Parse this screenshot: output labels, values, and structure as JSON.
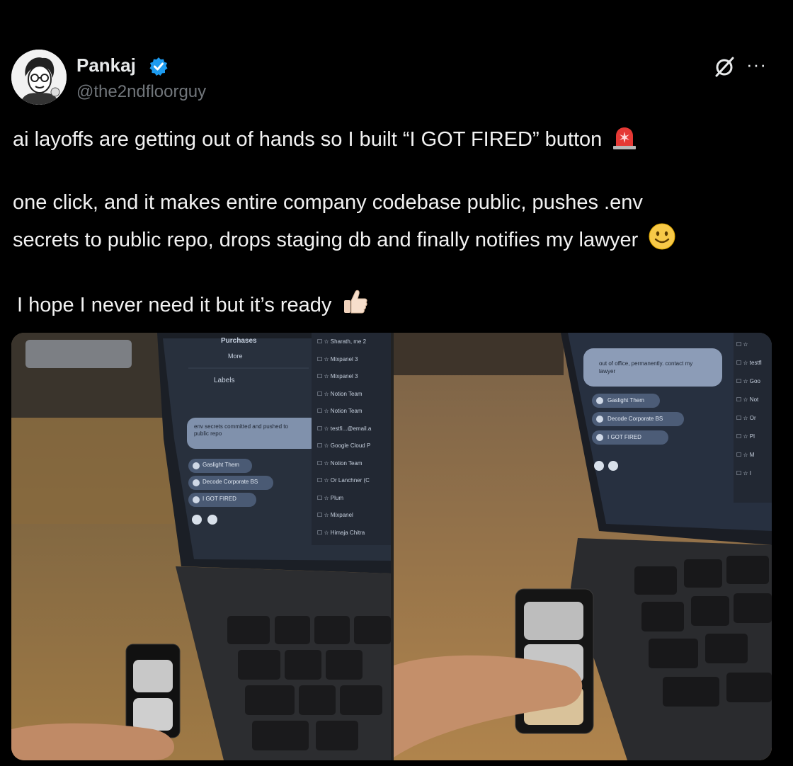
{
  "author": {
    "name": "Pankaj",
    "handle": "@the2ndfloorguy",
    "verified": true
  },
  "header_icons": [
    "grok-icon",
    "more-icon"
  ],
  "more_label": "···",
  "tweet": {
    "line1": "ai layoffs are getting out of hands so I built “I GOT FIRED” button",
    "line2": "one click, and it makes entire company codebase public, pushes .env",
    "line3": "secrets to public repo, drops staging db and finally notifies my lawyer",
    "line4": "I hope I never need it but it’s ready",
    "emojis": [
      "rotating-light-emoji",
      "smiling-face-emoji",
      "thumbs-up-emoji"
    ]
  },
  "media": {
    "left": {
      "sidebar": [
        "Purchases",
        "More",
        "Labels"
      ],
      "notification": "env secrets committed and pushed to public repo",
      "buttons": [
        "Gaslight Them",
        "Decode Corporate BS",
        "I GOT FIRED"
      ],
      "inbox_senders": [
        "Sharath, me 2",
        "Mixpanel 3",
        "Mixpanel 3",
        "Notion Team",
        "Notion Team",
        "testfi...@email.a",
        "Google Cloud P",
        "Notion Team",
        "Or Lanchner (C",
        "Plum",
        "Mixpanel",
        "Himaja Chitra"
      ]
    },
    "right": {
      "notification": "out of office, permanently. contact my lawyer",
      "buttons": [
        "Gaslight Them",
        "Decode Corporate BS",
        "I GOT FIRED"
      ],
      "inbox_senders": [
        "",
        "testfl",
        "Goo",
        "Not",
        "Or",
        "Pl",
        "M",
        "I"
      ]
    }
  },
  "colors": {
    "background": "#000000",
    "text": "#e7e9ea",
    "secondary": "#71767b",
    "verified": "#1d9bf0"
  }
}
